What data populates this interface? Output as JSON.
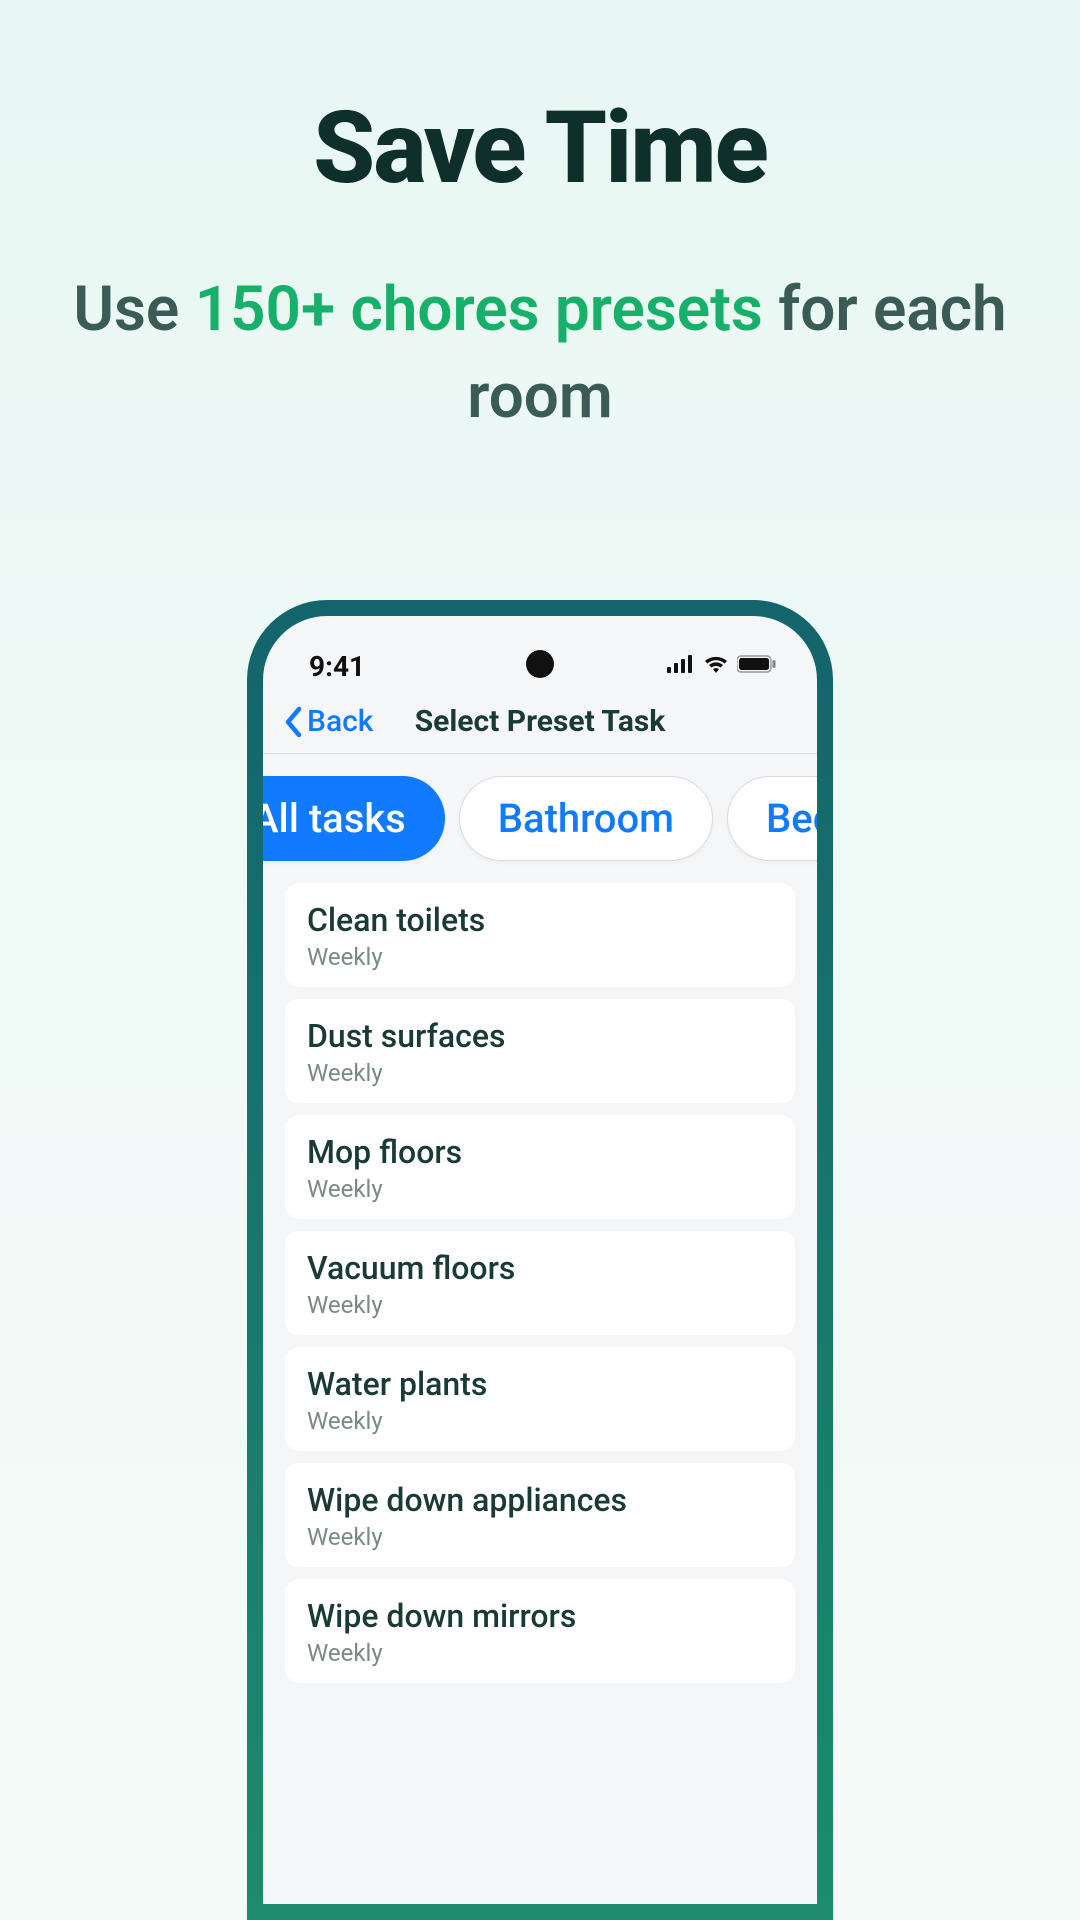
{
  "headline": "Save Time",
  "subhead_prefix": "Use ",
  "subhead_accent": "150+ chores presets",
  "subhead_suffix": " for each room",
  "statusbar": {
    "time": "9:41"
  },
  "nav": {
    "back_label": "Back",
    "title": "Select Preset Task"
  },
  "chips": [
    {
      "label": "All tasks",
      "active": true
    },
    {
      "label": "Bathroom",
      "active": false
    },
    {
      "label": "Bedroom",
      "active": false
    }
  ],
  "tasks": [
    {
      "title": "Clean toilets",
      "freq": "Weekly"
    },
    {
      "title": "Dust surfaces",
      "freq": "Weekly"
    },
    {
      "title": "Mop floors",
      "freq": "Weekly"
    },
    {
      "title": "Vacuum floors",
      "freq": "Weekly"
    },
    {
      "title": "Water plants",
      "freq": "Weekly"
    },
    {
      "title": "Wipe down appliances",
      "freq": "Weekly"
    },
    {
      "title": "Wipe down mirrors",
      "freq": "Weekly"
    }
  ]
}
